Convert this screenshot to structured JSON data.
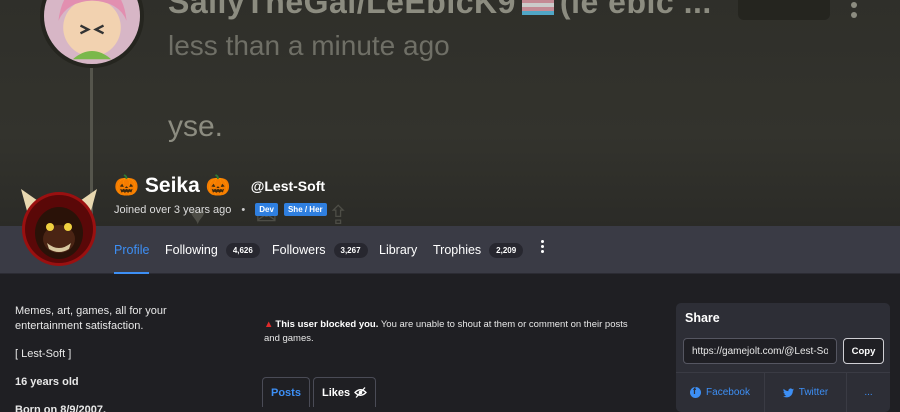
{
  "background_post": {
    "author": "SallyTheGal/LeEbicK9",
    "author_suffix": "(le ebic ...",
    "time": "less than a minute ago",
    "message": "yse."
  },
  "profile": {
    "display_name": "Seika",
    "username": "@Lest-Soft",
    "joined": "Joined over 3 years ago",
    "tags": [
      "Dev",
      "She / Her"
    ]
  },
  "nav": {
    "items": [
      {
        "label": "Profile",
        "count": ""
      },
      {
        "label": "Following",
        "count": "4,626"
      },
      {
        "label": "Followers",
        "count": "3,267"
      },
      {
        "label": "Library",
        "count": ""
      },
      {
        "label": "Trophies",
        "count": "2,209"
      }
    ]
  },
  "bio": {
    "line1": "Memes, art, games, all for your entertainment satisfaction.",
    "line2": "[ Lest-Soft ]",
    "line3": "16 years old",
    "line4": "Born on 8/9/2007."
  },
  "notice": {
    "bold": "This user blocked you.",
    "text": "You are unable to shout at them or comment on their posts and games."
  },
  "tabs": [
    {
      "label": "Posts"
    },
    {
      "label": "Likes"
    }
  ],
  "share": {
    "title": "Share",
    "url": "https://gamejolt.com/@Lest-Soft",
    "copy_label": "Copy",
    "facebook": "Facebook",
    "twitter": "Twitter",
    "more": "..."
  },
  "colors": {
    "accent": "#3d8ff5",
    "nav_bg": "#3a3b45",
    "page_bg": "#1f1f23",
    "card_bg": "#2d2e36",
    "warning": "#e02b2b"
  }
}
